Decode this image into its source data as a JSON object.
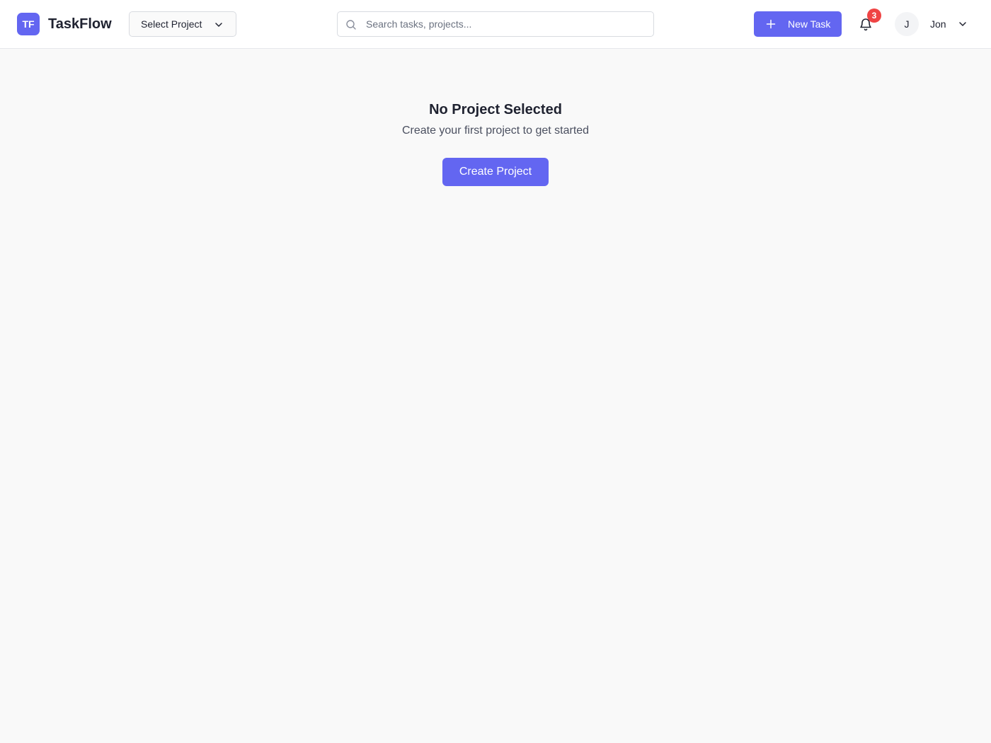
{
  "header": {
    "logo_text": "TF",
    "app_title": "TaskFlow",
    "project_select_label": "Select Project",
    "search_placeholder": "Search tasks, projects...",
    "new_task_label": "New Task",
    "notification_count": "3",
    "user_initial": "J",
    "user_name": "Jon"
  },
  "main": {
    "empty_title": "No Project Selected",
    "empty_subtitle": "Create your first project to get started",
    "create_button_label": "Create Project"
  },
  "icons": {
    "project_select": "chevron-down-icon",
    "search": "search-icon",
    "new_task": "plus-icon",
    "notifications": "bell-icon",
    "user_menu": "chevron-down-icon"
  },
  "colors": {
    "accent": "#6366f1",
    "badge": "#ef4444",
    "background": "#f9f9f9"
  }
}
